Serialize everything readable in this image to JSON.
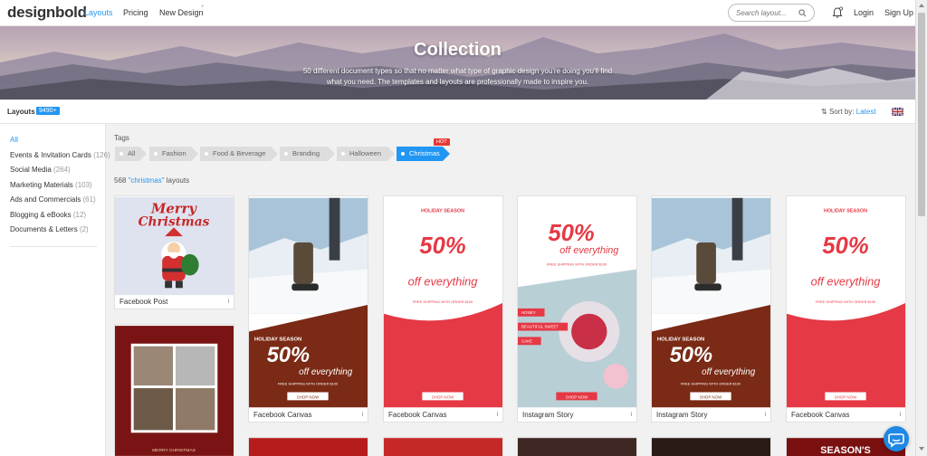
{
  "header": {
    "logo": "designbold",
    "nav": [
      "Layouts",
      "Pricing",
      "New Design"
    ],
    "new_design_sup": "+",
    "search_placeholder": "Search layout...",
    "login": "Login",
    "signup": "Sign Up"
  },
  "hero": {
    "title": "Collection",
    "subtitle": "50 different document types so that no matter what type of graphic design you're doing you'll find what you need. The templates and layouts are professionally made to inspire you."
  },
  "subbar": {
    "layouts_label": "Layouts",
    "layouts_count": "9490+",
    "sort_label": "Sort by:",
    "sort_value": "Latest"
  },
  "sidebar": {
    "items": [
      {
        "label": "All",
        "count": ""
      },
      {
        "label": "Events & Invitation Cards",
        "count": "(126)"
      },
      {
        "label": "Social Media",
        "count": "(264)"
      },
      {
        "label": "Marketing Materials",
        "count": "(103)"
      },
      {
        "label": "Ads and Commercials",
        "count": "(61)"
      },
      {
        "label": "Blogging & eBooks",
        "count": "(12)"
      },
      {
        "label": "Documents & Letters",
        "count": "(2)"
      }
    ]
  },
  "tags": {
    "label": "Tags",
    "items": [
      "All",
      "Fashion",
      "Food & Beverage",
      "Branding",
      "Halloween",
      "Christmas"
    ],
    "hot_badge": "HOT"
  },
  "results": {
    "count": "568",
    "query": "\"christmas\"",
    "suffix": "layouts"
  },
  "cards": [
    {
      "caption": "Facebook Post",
      "art": {
        "title1": "Merry",
        "title2": "Christmas"
      }
    },
    {
      "caption": "Facebook Canvas",
      "art": {
        "season": "HOLIDAY SEASON",
        "big": "50%",
        "script": "off everything",
        "small": "FREE SHIPPING WITH ORDER $100",
        "cta": "SHOP NOW"
      }
    },
    {
      "caption": "Facebook Canvas",
      "art": {
        "season": "HOLIDAY SEASON",
        "big": "50%",
        "script": "off everything",
        "small": "FREE SHIPPING WITH ORDER $100",
        "cta": "SHOP NOW"
      }
    },
    {
      "caption": "Instagram Story",
      "art": {
        "big": "50%",
        "script": "off everything",
        "small": "FREE SHIPPING WITH ORDER $100",
        "labels": [
          "HONEY",
          "BEAUTIFUL SWEET",
          "CAKE"
        ],
        "cta": "SHOP NOW"
      }
    },
    {
      "caption": "Instagram Story",
      "art": {
        "season": "HOLIDAY SEASON",
        "big": "50%",
        "script": "off everything",
        "small": "FREE SHIPPING WITH ORDER $100",
        "cta": "SHOP NOW"
      }
    },
    {
      "caption": "Facebook Canvas",
      "art": {
        "season": "HOLIDAY SEASON",
        "big": "50%",
        "script": "off everything",
        "small": "FREE SHIPPING WITH ORDER $100",
        "cta": "SHOP NOW"
      }
    },
    {
      "caption": "",
      "art": {
        "bottom": "MERRY CHRISTMAS"
      }
    },
    {
      "caption": "",
      "art": {}
    },
    {
      "caption": "",
      "art": {}
    },
    {
      "caption": "",
      "art": {}
    },
    {
      "caption": "",
      "art": {
        "top": "SEASON'S"
      }
    },
    {
      "caption": "",
      "art": {}
    }
  ],
  "colors": {
    "accent": "#2196f3",
    "red": "#e53945",
    "dark_brown": "#7a2a15"
  }
}
